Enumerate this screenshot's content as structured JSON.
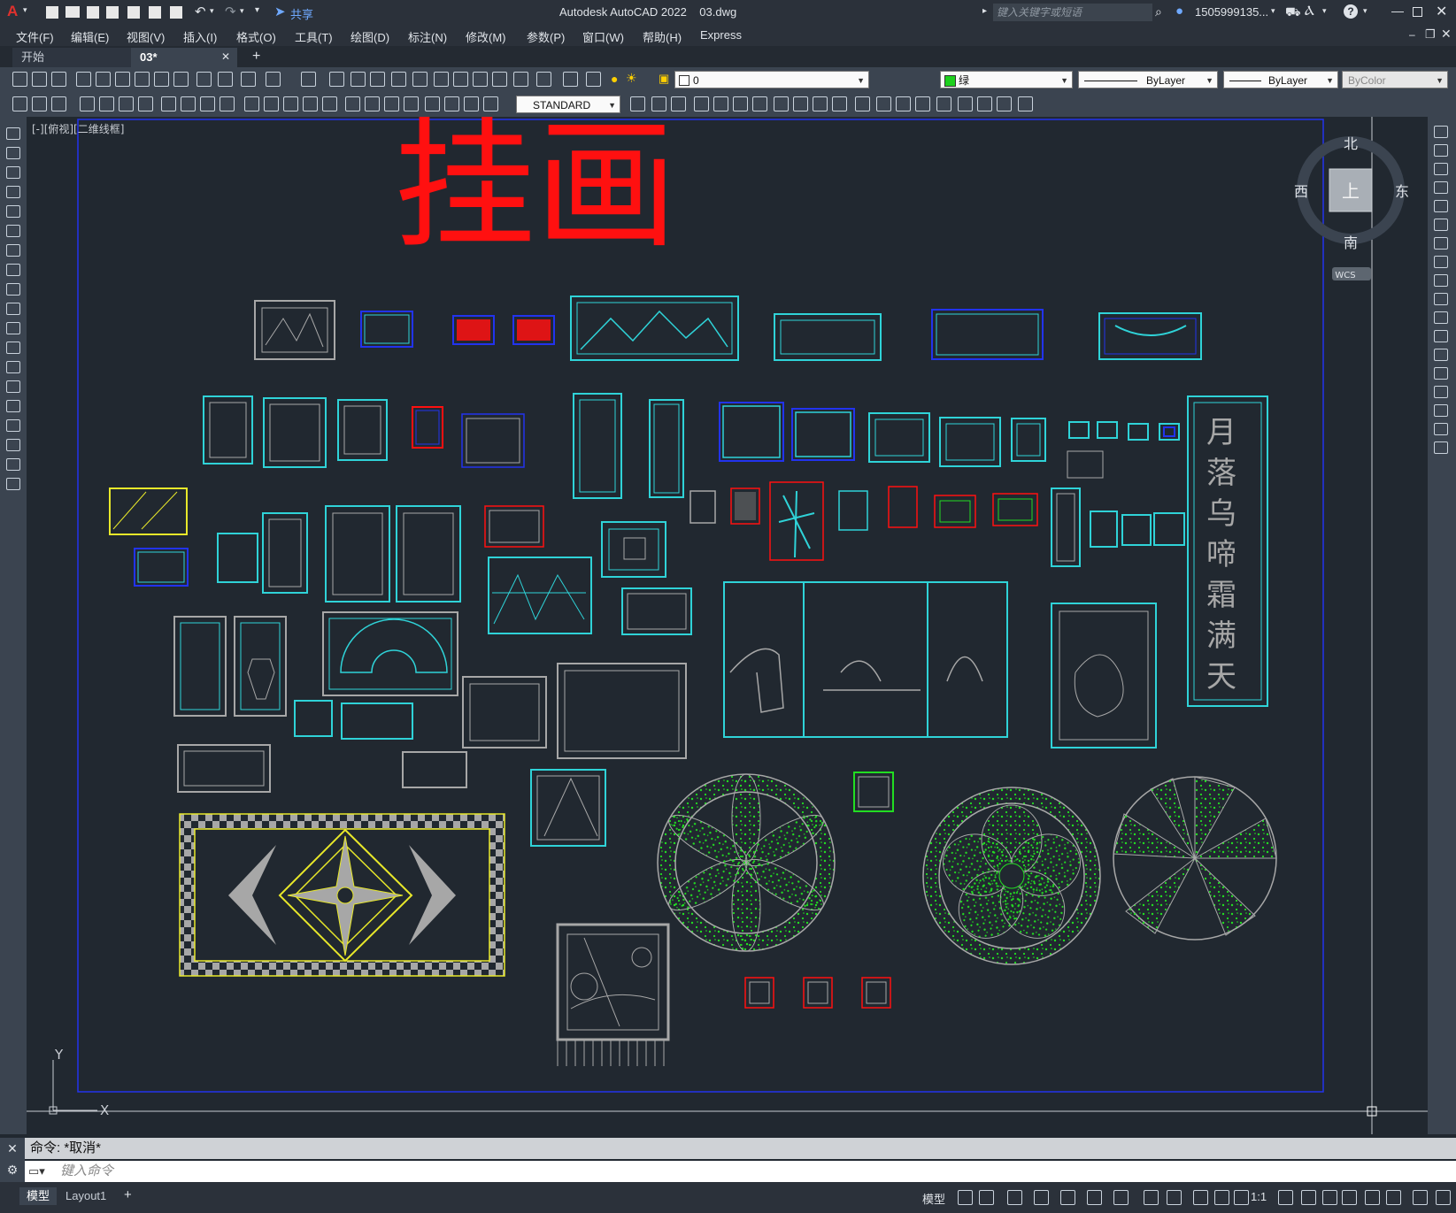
{
  "window": {
    "title": "Autodesk AutoCAD 2022    03.dwg",
    "search_placeholder": "键入关键字或短语",
    "user": "1505999135...",
    "share_label": "共享"
  },
  "menu": [
    "文件(F)",
    "编辑(E)",
    "视图(V)",
    "插入(I)",
    "格式(O)",
    "工具(T)",
    "绘图(D)",
    "标注(N)",
    "修改(M)",
    "参数(P)",
    "窗口(W)",
    "帮助(H)",
    "Express"
  ],
  "tabs": [
    {
      "label": "开始"
    },
    {
      "label": "03*"
    }
  ],
  "toolbar": {
    "layer_value": "0",
    "color_value": "绿",
    "linetype_value": "ByLayer",
    "lineweight_value": "ByLayer",
    "plotstyle_value": "ByColor",
    "textstyle_value": "STANDARD"
  },
  "viewport": {
    "label": "[-][俯视][二维线框]",
    "drawing_title": "挂画",
    "vertical_text": [
      "月",
      "落",
      "乌",
      "啼",
      "霜",
      "满",
      "天"
    ],
    "ucs_x": "X",
    "ucs_y": "Y"
  },
  "viewcube": {
    "north": "北",
    "south": "南",
    "east": "东",
    "west": "西",
    "face": "上",
    "wcs": "WCS"
  },
  "command": {
    "history": "命令: *取消*",
    "placeholder": "键入命令"
  },
  "layouts": [
    "模型",
    "Layout1"
  ],
  "status": {
    "model_label": "模型",
    "scale": "1:1"
  },
  "colors": {
    "cyan": "#2fd3d8",
    "red": "#ff1010",
    "green": "#22dd22",
    "blue": "#2233ee",
    "yellow": "#e8e82a",
    "gray": "#a7a7a7",
    "background": "#212830"
  }
}
